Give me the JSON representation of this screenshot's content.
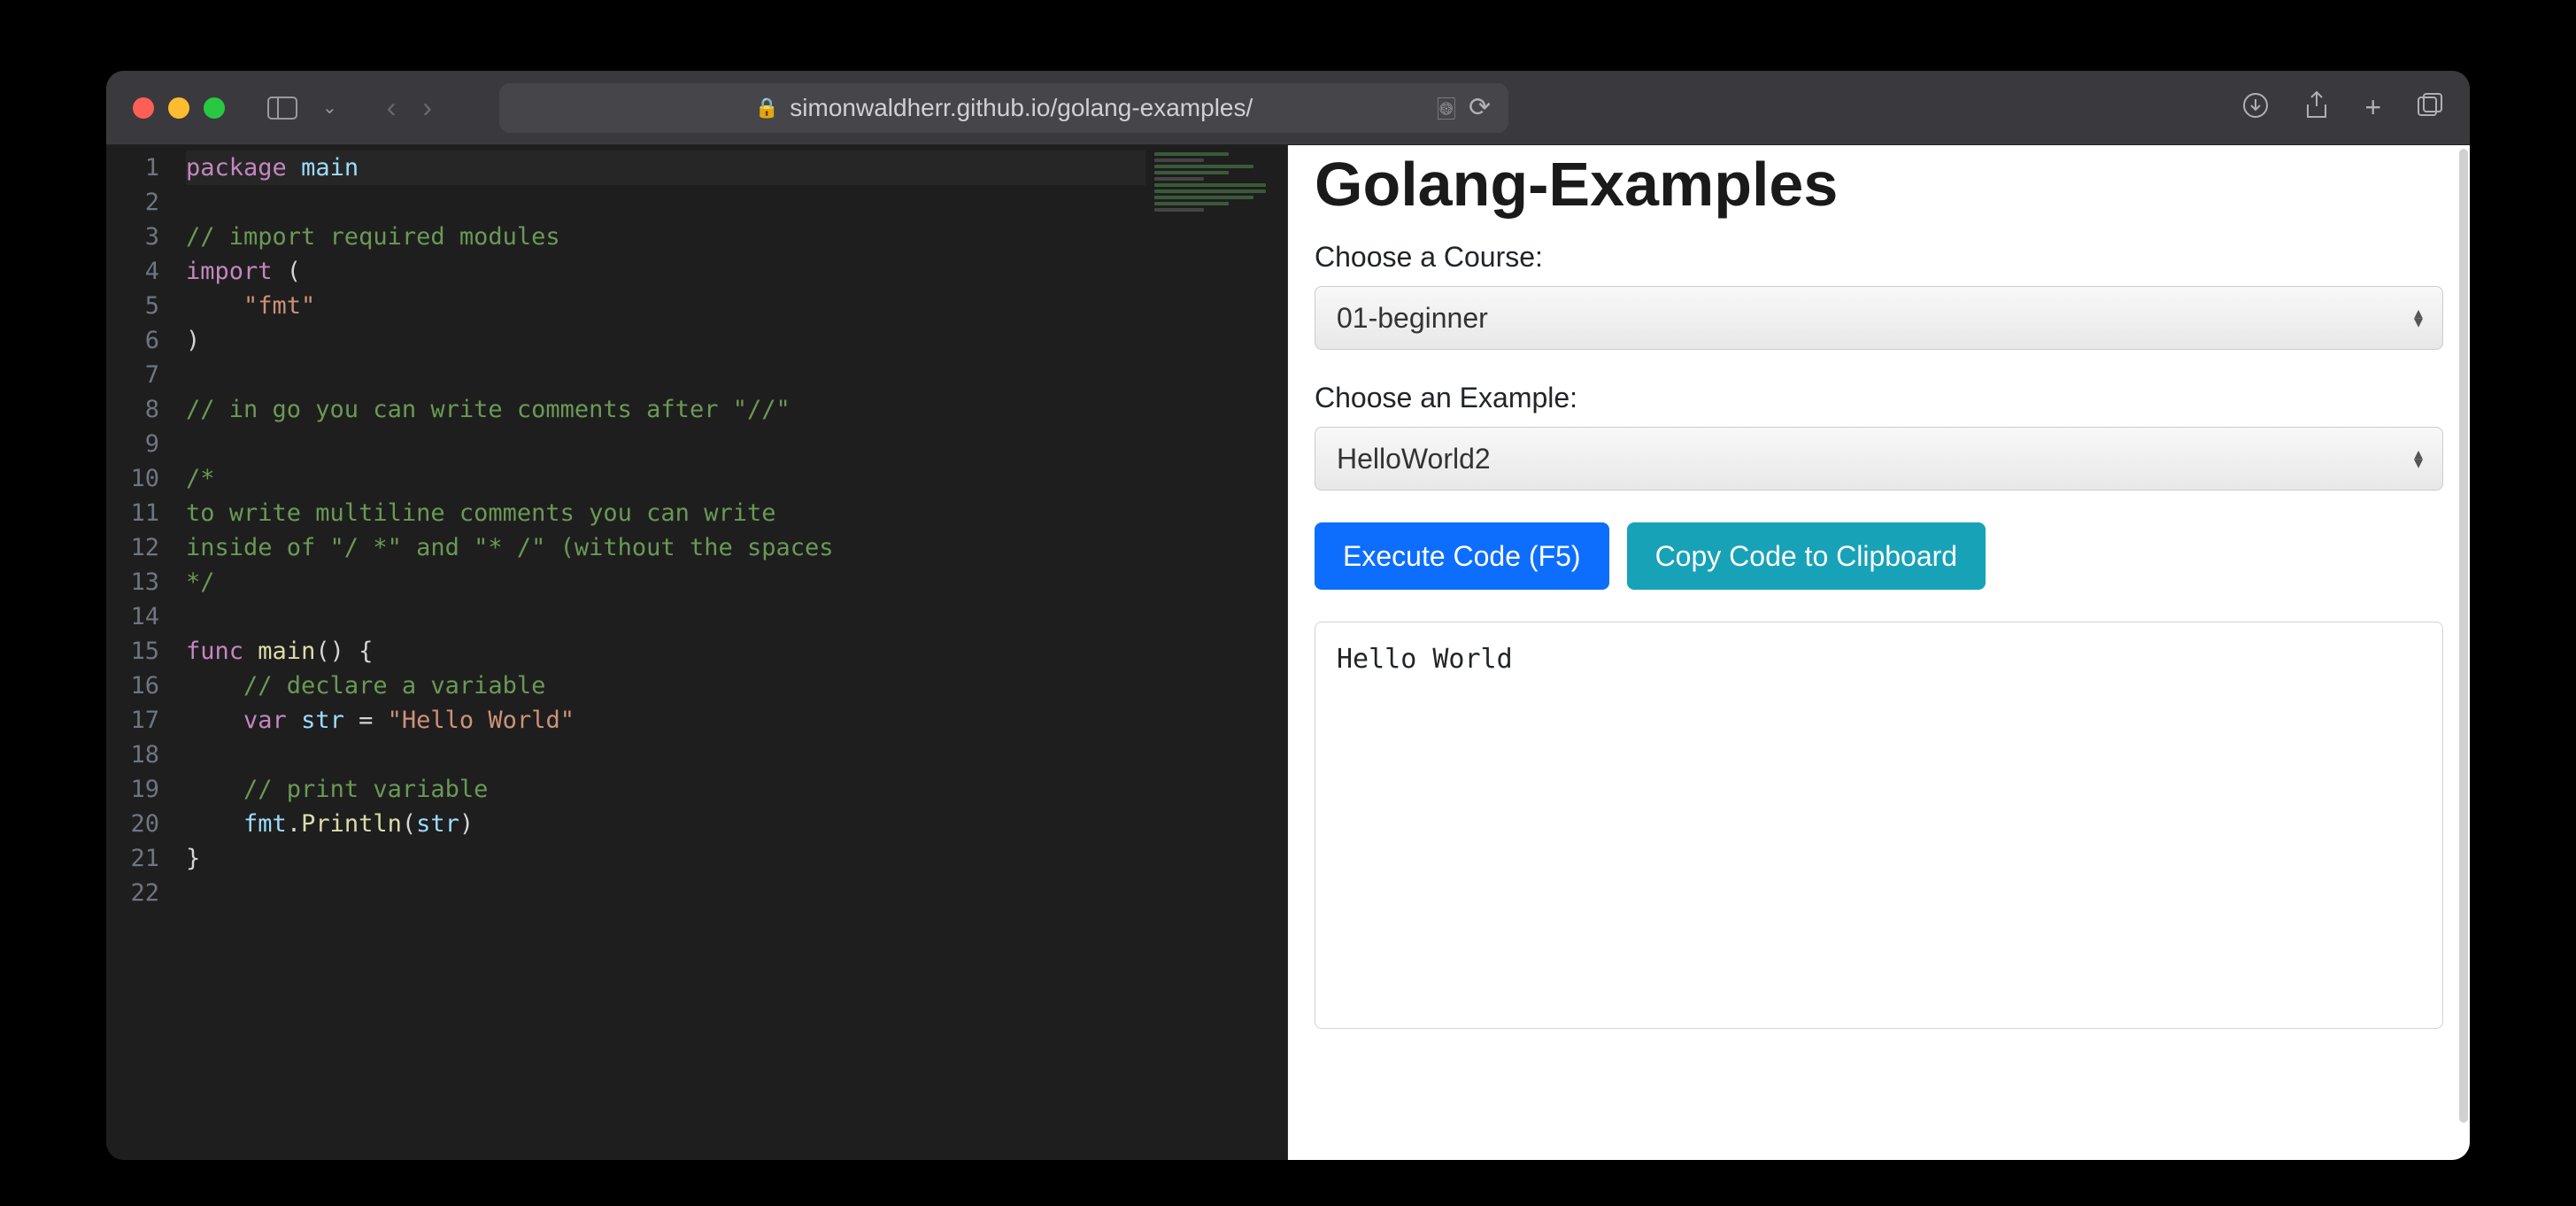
{
  "browser": {
    "url": "simonwaldherr.github.io/golang-examples/"
  },
  "editor": {
    "lines": [
      [
        [
          "kw",
          "package"
        ],
        [
          "plain",
          " "
        ],
        [
          "ident",
          "main"
        ]
      ],
      [],
      [
        [
          "comment",
          "// import required modules"
        ]
      ],
      [
        [
          "kw",
          "import"
        ],
        [
          "plain",
          " ("
        ]
      ],
      [
        [
          "plain",
          "    "
        ],
        [
          "str",
          "\"fmt\""
        ]
      ],
      [
        [
          "plain",
          ")"
        ]
      ],
      [],
      [
        [
          "comment",
          "// in go you can write comments after \"//\""
        ]
      ],
      [],
      [
        [
          "comment",
          "/*"
        ]
      ],
      [
        [
          "comment",
          "to write multiline comments you can write"
        ]
      ],
      [
        [
          "comment",
          "inside of \"/ *\" and \"* /\" (without the spaces"
        ]
      ],
      [
        [
          "comment",
          "*/"
        ]
      ],
      [],
      [
        [
          "kw",
          "func"
        ],
        [
          "plain",
          " "
        ],
        [
          "func",
          "main"
        ],
        [
          "plain",
          "() {"
        ]
      ],
      [
        [
          "plain",
          "    "
        ],
        [
          "comment",
          "// declare a variable"
        ]
      ],
      [
        [
          "plain",
          "    "
        ],
        [
          "kw",
          "var"
        ],
        [
          "plain",
          " "
        ],
        [
          "ident",
          "str"
        ],
        [
          "plain",
          " = "
        ],
        [
          "str",
          "\"Hello World\""
        ]
      ],
      [],
      [
        [
          "plain",
          "    "
        ],
        [
          "comment",
          "// print variable"
        ]
      ],
      [
        [
          "plain",
          "    "
        ],
        [
          "ident",
          "fmt"
        ],
        [
          "plain",
          "."
        ],
        [
          "func",
          "Println"
        ],
        [
          "plain",
          "("
        ],
        [
          "ident",
          "str"
        ],
        [
          "plain",
          ")"
        ]
      ],
      [
        [
          "plain",
          "}"
        ]
      ],
      []
    ]
  },
  "panel": {
    "title": "Golang-Examples",
    "course_label": "Choose a Course:",
    "course_value": "01-beginner",
    "example_label": "Choose an Example:",
    "example_value": "HelloWorld2",
    "execute_label": "Execute Code (F5)",
    "copy_label": "Copy Code to Clipboard",
    "output": "Hello World"
  }
}
